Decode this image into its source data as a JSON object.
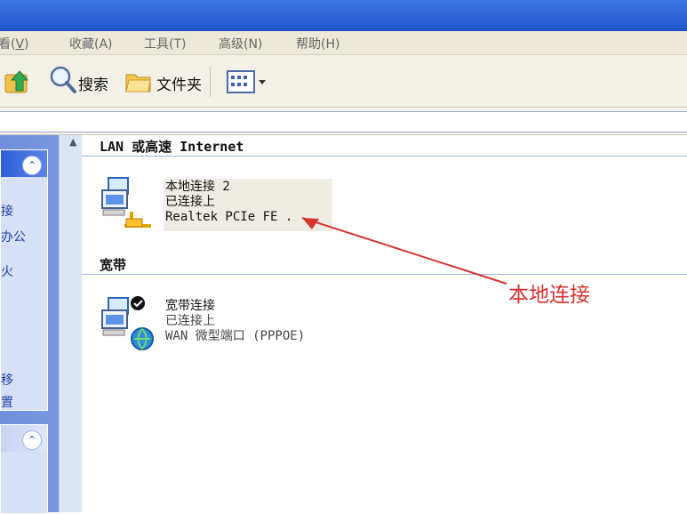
{
  "menu": {
    "items": [
      "查看(V)",
      "收藏(A)",
      "工具(T)",
      "高级(N)",
      "帮助(H)"
    ],
    "partial_first": "查看(V)"
  },
  "toolbar": {
    "search_label": "搜索",
    "folders_label": "文件夹"
  },
  "groups": {
    "lan": {
      "header": "LAN 或高速 Internet",
      "item": {
        "name": "本地连接 2",
        "status": "已连接上",
        "device": "Realtek PCIe FE ."
      }
    },
    "broadband": {
      "header": "宽带",
      "item": {
        "name": "宽带连接",
        "status": "已连接上",
        "device": "WAN 微型端口 (PPPOE)"
      }
    }
  },
  "sidebar": {
    "task_lines": [
      "接",
      "办公",
      "火",
      "",
      "",
      "移",
      "置"
    ]
  },
  "annotation": {
    "text": "本地连接",
    "color": "#d8332f"
  },
  "colors": {
    "titlebar": "#2a62d6",
    "menubar": "#ece9d8",
    "sidebar": "#7b9ae0",
    "annotation": "#d8332f"
  },
  "icons": {
    "up": "folder-up-icon",
    "search": "search-icon",
    "folders": "folders-icon",
    "views": "views-icon"
  }
}
